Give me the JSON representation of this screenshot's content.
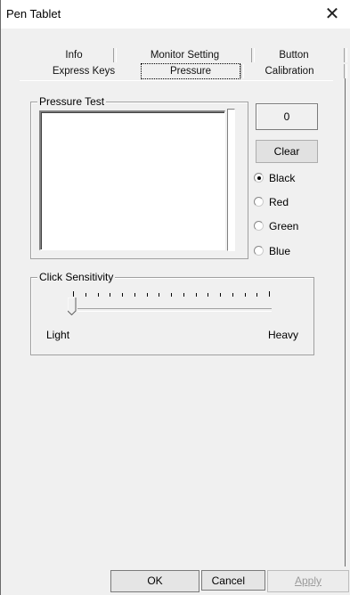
{
  "window": {
    "title": "Pen Tablet",
    "close_glyph": "✕"
  },
  "tabs": {
    "row1": [
      "Info",
      "Monitor Setting",
      "Button"
    ],
    "row2": [
      "Express Keys",
      "Pressure",
      "Calibration"
    ],
    "selected": "Pressure"
  },
  "pressure_test": {
    "label": "Pressure Test",
    "value": "0",
    "clear_label": "Clear",
    "colors": [
      {
        "label": "Black",
        "checked": true
      },
      {
        "label": "Red",
        "checked": false
      },
      {
        "label": "Green",
        "checked": false
      },
      {
        "label": "Blue",
        "checked": false
      }
    ]
  },
  "click_sensitivity": {
    "label": "Click Sensitivity",
    "min_label": "Light",
    "max_label": "Heavy",
    "level": 0
  },
  "footer": {
    "ok": "OK",
    "cancel": "Cancel",
    "apply": "Apply"
  }
}
